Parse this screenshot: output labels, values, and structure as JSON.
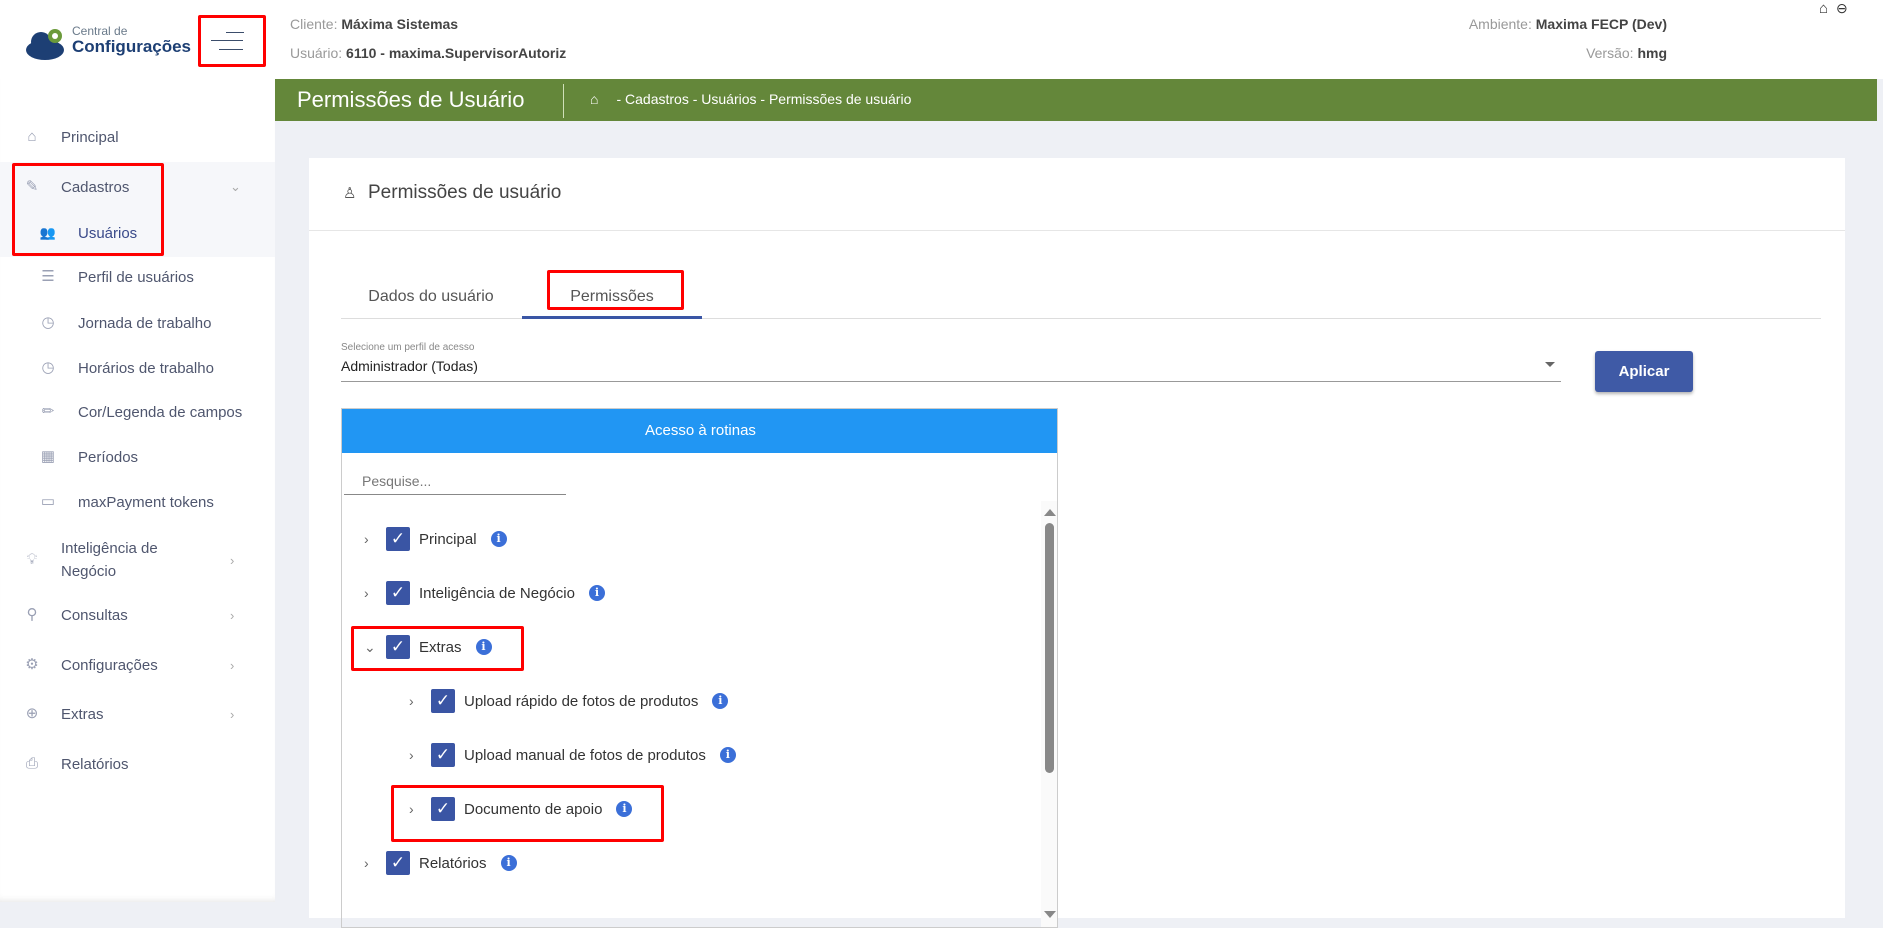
{
  "header": {
    "logo": {
      "line1": "Central de",
      "line2": "Configurações"
    },
    "cliente_label": "Cliente:",
    "cliente_value": "Máxima Sistemas",
    "usuario_label": "Usuário:",
    "usuario_value": "6110 - maxima.SupervisorAutoriz",
    "ambiente_label": "Ambiente:",
    "ambiente_value": "Maxima FECP (Dev)",
    "versao_label": "Versão:",
    "versao_value": "hmg"
  },
  "sidebar": {
    "items": [
      {
        "label": "Principal",
        "icon": "home-icon"
      },
      {
        "label": "Cadastros",
        "icon": "edit-icon"
      },
      {
        "label": "Usuários",
        "icon": "users-icon"
      },
      {
        "label": "Perfil de usuários",
        "icon": "checklist-icon"
      },
      {
        "label": "Jornada de trabalho",
        "icon": "clock-icon"
      },
      {
        "label": "Horários de trabalho",
        "icon": "clock-icon"
      },
      {
        "label": "Cor/Legenda de campos",
        "icon": "pencil-icon"
      },
      {
        "label": "Períodos",
        "icon": "calendar-icon"
      },
      {
        "label": "maxPayment tokens",
        "icon": "credit-card-icon"
      },
      {
        "label": "Inteligência de Negócio",
        "icon": "lightbulb-icon"
      },
      {
        "label": "Consultas",
        "icon": "search-icon"
      },
      {
        "label": "Configurações",
        "icon": "gear-icon"
      },
      {
        "label": "Extras",
        "icon": "plus-circle-icon"
      },
      {
        "label": "Relatórios",
        "icon": "printer-icon"
      }
    ]
  },
  "page": {
    "title": "Permissões de Usuário",
    "breadcrumb": "- Cadastros - Usuários - Permissões de usuário"
  },
  "card": {
    "title": "Permissões de usuário",
    "tabs": [
      {
        "label": "Dados do usuário"
      },
      {
        "label": "Permissões",
        "active": true
      }
    ],
    "select_label": "Selecione um perfil de acesso",
    "select_value": "Administrador (Todas)",
    "apply_label": "Aplicar",
    "panel_title": "Acesso à rotinas",
    "search_placeholder": "Pesquise...",
    "tree": [
      {
        "label": "Principal",
        "checked": true,
        "expanded": false,
        "level": 0
      },
      {
        "label": "Inteligência de Negócio",
        "checked": true,
        "expanded": false,
        "level": 0
      },
      {
        "label": "Extras",
        "checked": true,
        "expanded": true,
        "level": 0
      },
      {
        "label": "Upload rápido de fotos de produtos",
        "checked": true,
        "expanded": false,
        "level": 1
      },
      {
        "label": "Upload manual de fotos de produtos",
        "checked": true,
        "expanded": false,
        "level": 1
      },
      {
        "label": "Documento de apoio",
        "checked": true,
        "expanded": false,
        "level": 1
      },
      {
        "label": "Relatórios",
        "checked": true,
        "expanded": false,
        "level": 0
      }
    ]
  },
  "colors": {
    "green_bar": "#64873a",
    "primary": "#3a55a4",
    "panel_header": "#2196f3",
    "highlight": "#ff0000"
  }
}
